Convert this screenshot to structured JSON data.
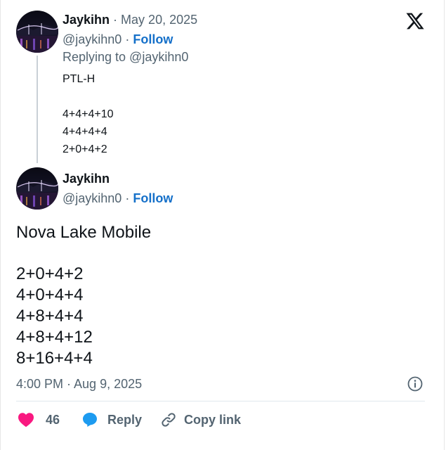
{
  "colors": {
    "follow_blue": "#1570c9",
    "muted_gray": "#536471",
    "text_black": "#0f1419",
    "like_pink": "#f91880",
    "reply_blue": "#1d9bf0"
  },
  "brand": {
    "logo_icon": "x-logo-icon"
  },
  "reply_tweet": {
    "author_name": "Jaykihn",
    "date_sep": " · ",
    "date": "May 20, 2025",
    "handle": "@jaykihn0",
    "follow_sep": " · ",
    "follow_label": "Follow",
    "replying_to": "Replying to @jaykihn0",
    "lines": [
      "PTL-H",
      "4+4+4+10",
      "4+4+4+4",
      "2+0+4+2"
    ]
  },
  "main_tweet": {
    "author_name": "Jaykihn",
    "handle": "@jaykihn0",
    "follow_sep": " · ",
    "follow_label": "Follow",
    "lines": [
      "Nova Lake Mobile",
      "2+0+4+2",
      "4+0+4+4",
      "4+8+4+4",
      "4+8+4+12",
      "8+16+4+4"
    ],
    "timestamp": "4:00 PM · Aug 9, 2025"
  },
  "actions": {
    "like_count": "46",
    "reply_label": "Reply",
    "copy_link_label": "Copy link"
  }
}
